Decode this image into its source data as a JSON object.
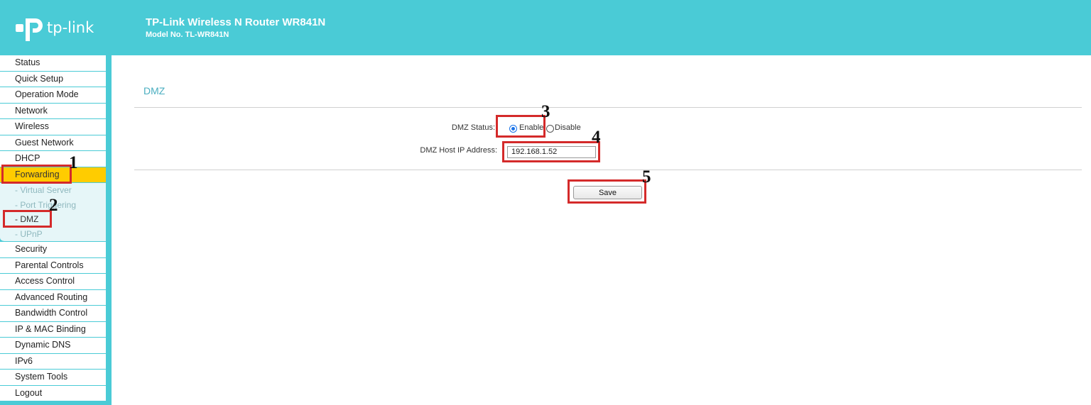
{
  "header": {
    "logo_text": "tp-link",
    "title": "TP-Link Wireless N Router WR841N",
    "model": "Model No. TL-WR841N",
    "bg_color": "#4acbd6"
  },
  "sidebar": {
    "items_top": [
      "Status",
      "Quick Setup",
      "Operation Mode",
      "Network",
      "Wireless",
      "Guest Network",
      "DHCP"
    ],
    "active_item": "Forwarding",
    "subitems": [
      "- Virtual Server",
      "- Port Triggering",
      "- DMZ",
      "- UPnP"
    ],
    "active_subitem": "- DMZ",
    "items_bottom": [
      "Security",
      "Parental Controls",
      "Access Control",
      "Advanced Routing",
      "Bandwidth Control",
      "IP & MAC Binding",
      "Dynamic DNS",
      "IPv6",
      "System Tools",
      "Logout"
    ]
  },
  "main": {
    "page_title": "DMZ",
    "status_label": "DMZ Status:",
    "enable_label": "Enable",
    "disable_label": "Disable",
    "status_value": "Enable",
    "host_ip_label": "DMZ Host IP Address:",
    "host_ip_value": "192.168.1.52",
    "save_label": "Save"
  },
  "annotations": {
    "n1": "1",
    "n2": "2",
    "n3": "3",
    "n4": "4",
    "n5": "5",
    "color": "#d42a2a"
  }
}
